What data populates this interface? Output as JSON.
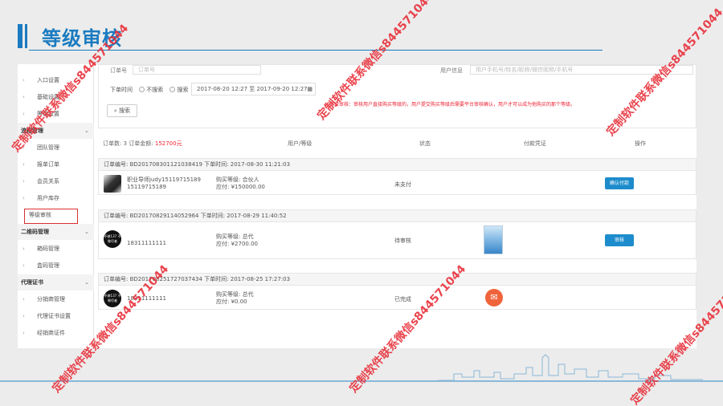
{
  "slide": {
    "title": "等级审核"
  },
  "sidebar": {
    "items": [
      {
        "label": "入口设置",
        "type": "item"
      },
      {
        "label": "基础设置",
        "type": "item"
      },
      {
        "label": "等级设置",
        "type": "item"
      },
      {
        "label": "流程管理",
        "type": "section"
      },
      {
        "label": "团队管理",
        "type": "item"
      },
      {
        "label": "报单订单",
        "type": "item"
      },
      {
        "label": "会员关系",
        "type": "item"
      },
      {
        "label": "用户库存",
        "type": "item"
      },
      {
        "label": "等级审核",
        "type": "item",
        "active": true
      },
      {
        "label": "二维码管理",
        "type": "section"
      },
      {
        "label": "箱码管理",
        "type": "item"
      },
      {
        "label": "盒码管理",
        "type": "item"
      },
      {
        "label": "代理证书",
        "type": "section"
      },
      {
        "label": "分销商管理",
        "type": "item"
      },
      {
        "label": "代理证书设置",
        "type": "item"
      },
      {
        "label": "经销商证件",
        "type": "item"
      }
    ]
  },
  "filter": {
    "order_no_label": "订单号",
    "order_no_placeholder": "订单号",
    "user_info_label": "用户信息",
    "user_info_placeholder": "用户手机号/姓名/昵称/微信昵称/手机号",
    "order_time_label": "下单时间",
    "radio_no_search": "不搜索",
    "radio_search": "搜索",
    "date_range": "2017-08-20 12:27 至 2017-09-20 12:27",
    "search_button": "搜索",
    "note": "等级审核：审核用户直接购买等级的，用户提交购买等级后需要平台审核确认，用户才可以成为他购买的那个等级。"
  },
  "summary": {
    "prefix": "订单数: 3 订单金额:",
    "amount": "152700元",
    "col_user": "用户/等级",
    "col_status": "状态",
    "col_proof": "付款凭证",
    "col_action": "操作"
  },
  "orders": [
    {
      "header": "订单编号: BD20170830112103841​9 下单时间: 2017-08-30 11:21:03",
      "name": "职业导师judy15119715189",
      "phone": "15119715189",
      "level": "购买等级: 合伙人",
      "amount": "应付: ¥150000.00",
      "status": "未支付",
      "action": "确认付款"
    },
    {
      "header": "订单编号: BD20170829114052964 下单时间: 2017-08-29 11:40:52",
      "name": "",
      "phone": "18311111111",
      "level": "购买等级: 总代",
      "amount": "应付: ¥2700.00",
      "status": "待审核",
      "action": "审核"
    },
    {
      "header": "订单编号: BD20170825172703743​4 下单时间: 2017-08-25 17:27:03",
      "name": "",
      "phone": "18311111111",
      "level": "购买等级: 总代",
      "amount": "应付: ¥0.00",
      "status": "已完成",
      "action": ""
    }
  ],
  "avatar_text": "不做137\n不做尽者",
  "watermark": "定制软件联系微信s844571044",
  "colors": {
    "accent": "#1a7bc0",
    "button": "#1d8ccc",
    "warning": "#e23333"
  }
}
